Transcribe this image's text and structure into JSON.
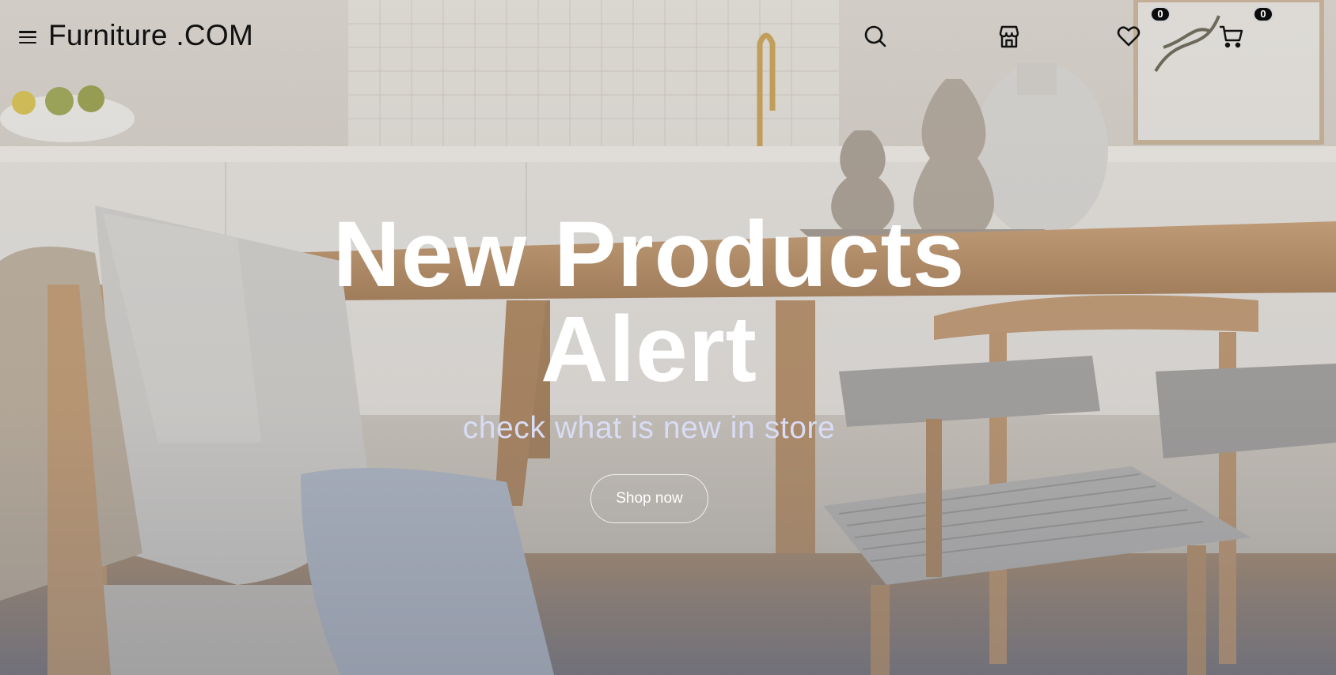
{
  "header": {
    "logo": "Furniture .COM",
    "menu_icon": "hamburger-menu-icon",
    "search_icon": "search-icon",
    "store_icon": "store-icon",
    "wishlist_icon": "heart-icon",
    "wishlist_count": "0",
    "cart_icon": "shopping-cart-icon",
    "cart_count": "0"
  },
  "hero": {
    "title": "New Products Alert",
    "subtitle": "check what is new in store",
    "cta_label": "Shop now"
  },
  "colors": {
    "title": "#ffffff",
    "subtitle": "#d9dcf5",
    "header_text": "#111111",
    "badge": "#0c0c0c"
  }
}
